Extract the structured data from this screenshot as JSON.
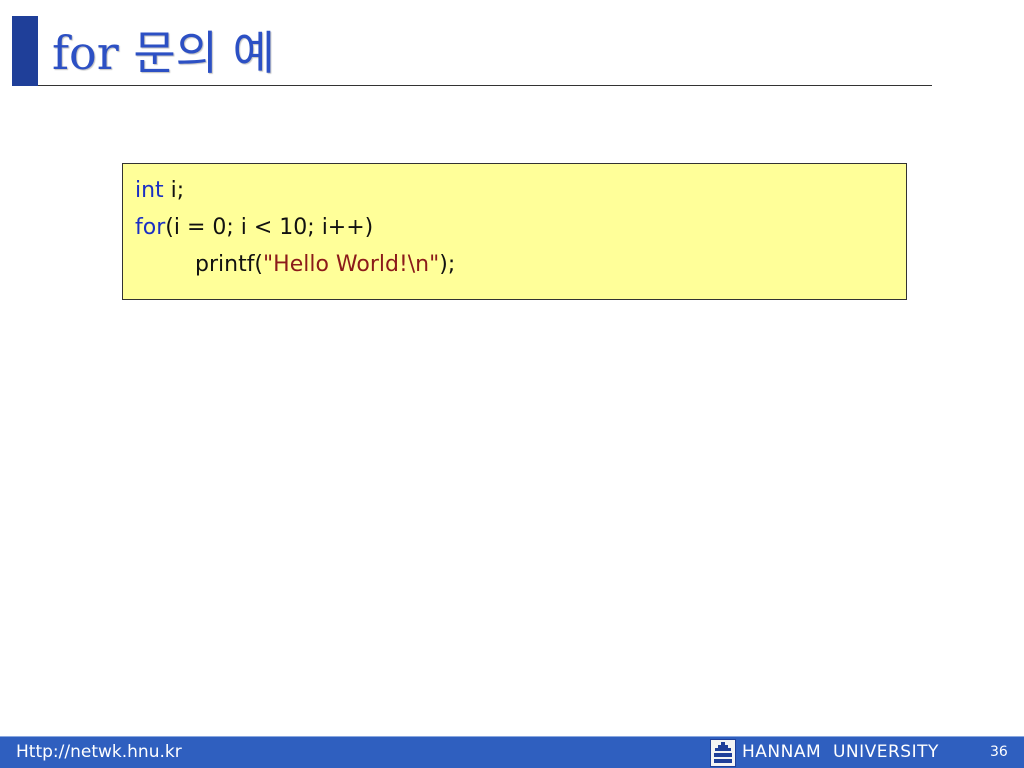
{
  "slide": {
    "title": "for 문의 예"
  },
  "code": {
    "line1": {
      "kw": "int",
      "rest": " i;"
    },
    "line2": {
      "kw": "for",
      "rest": "(i = 0; i < 10; i++)"
    },
    "line3": {
      "pre": "printf(",
      "str": "\"Hello World!\\n\"",
      "post": ");"
    }
  },
  "footer": {
    "url": "Http://netwk.hnu.kr",
    "university": "HANNAM  UNIVERSITY",
    "page_number": "36",
    "logo_icon": "hannam-logo-icon"
  },
  "colors": {
    "title": "#2c50c4",
    "title_bar": "#1f3f99",
    "code_background": "#ffff99",
    "keyword": "#1a2fc4",
    "string": "#8b1a1a",
    "footer_background": "#2f5fbf"
  }
}
